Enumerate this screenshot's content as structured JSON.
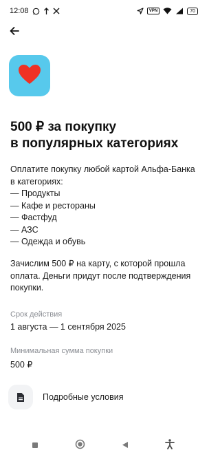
{
  "status_bar": {
    "time": "12:08",
    "left_icons": [
      "whatsapp-icon",
      "upload-icon",
      "x-icon"
    ],
    "right_icons": [
      "location-icon",
      "vpn-icon",
      "wifi-icon",
      "signal-icon"
    ],
    "vpn_label": "VPN",
    "battery": "70"
  },
  "promo": {
    "icon": "heart-icon",
    "icon_bg_color": "#57c9ec",
    "heart_color": "#ef3124",
    "title_lines": [
      "500 ₽ за покупку",
      "в популярных категориях"
    ],
    "description_lines": [
      "Оплатите покупку любой картой Альфа-Банка",
      "в категориях:",
      "— Продукты",
      "— Кафе и рестораны",
      "— Фастфуд",
      "— АЗС",
      "— Одежда и обувь"
    ],
    "credit_text": "Зачислим 500 ₽ на карту, с которой прошла оплата. Деньги придут после подтверждения покупки."
  },
  "validity": {
    "label": "Срок действия",
    "value": "1 августа — 1 сентября 2025"
  },
  "min_amount": {
    "label": "Минимальная сумма покупки",
    "value": "500 ₽"
  },
  "conditions": {
    "icon": "document-icon",
    "label": "Подробные условия"
  },
  "nav_bar": {
    "items": [
      "recents-icon",
      "home-icon",
      "back-icon",
      "accessibility-icon"
    ]
  }
}
